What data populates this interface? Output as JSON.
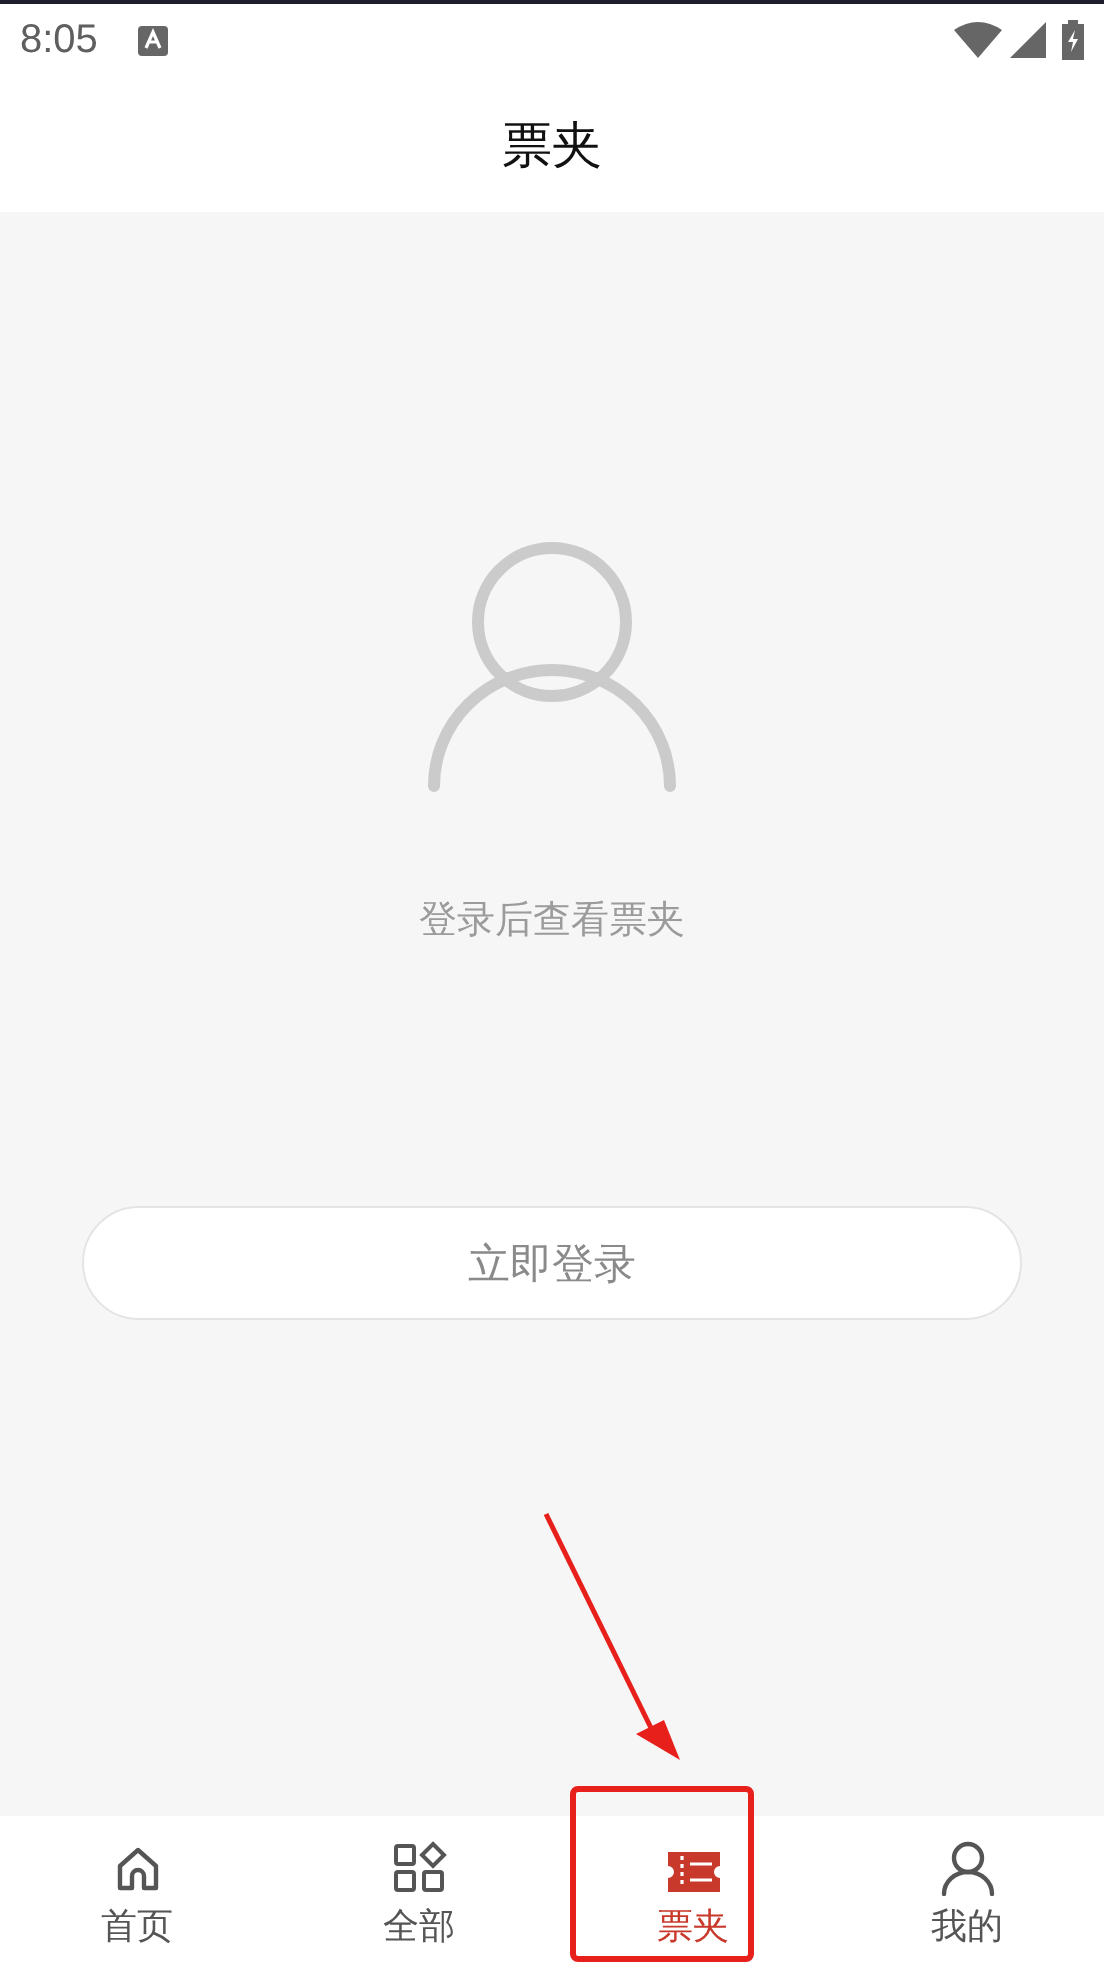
{
  "status_bar": {
    "time": "8:05"
  },
  "header": {
    "title": "票夹"
  },
  "empty_state": {
    "message": "登录后查看票夹",
    "button": "立即登录"
  },
  "tabs": [
    {
      "kind": "home",
      "label": "首页",
      "selected": false
    },
    {
      "kind": "all",
      "label": "全部",
      "selected": false
    },
    {
      "kind": "ticket",
      "label": "票夹",
      "selected": true
    },
    {
      "kind": "user",
      "label": "我的",
      "selected": false
    }
  ]
}
